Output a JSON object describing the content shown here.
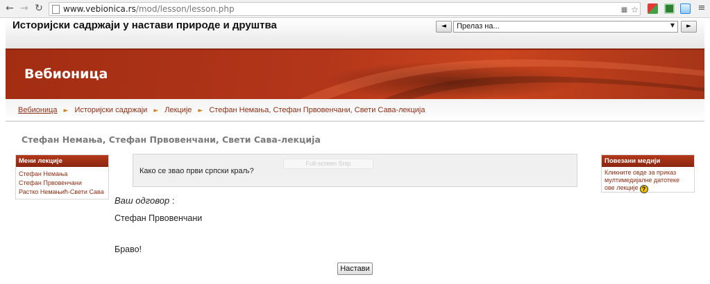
{
  "browser": {
    "back_glyph": "←",
    "forward_glyph": "→",
    "reload_glyph": "↻",
    "url_host": "www.vebionica.rs",
    "url_path": "/mod/lesson/lesson.php",
    "star_glyph": "☆"
  },
  "header": {
    "course_title": "Историјски садржаји у настави природе и друштва",
    "jump_prev": "◄",
    "jump_next": "►",
    "jump_select_value": "Прелаз на...",
    "jump_select_arrow": "▼"
  },
  "banner": {
    "site_name": "Вебионица"
  },
  "breadcrumb": {
    "items": [
      "Вебионица",
      "Историјски садржаји",
      "Лекције",
      "Стефан Немања, Стефан Првовенчани, Свети Сава-лекција"
    ],
    "separator": "►"
  },
  "page_title": "Стефан Немања, Стефан Првовенчани, Свети Сава-лекција",
  "lesson_menu": {
    "heading": "Мени лекције",
    "items": [
      "Стефан Немања",
      "Стефан Првовенчани",
      "Растко Немањић-Свети Сава"
    ]
  },
  "related_media": {
    "heading": "Повезани медији",
    "text_line1": "Кликните овде за приказ",
    "text_line2": "мултимедијалне датотеке",
    "text_line3": "ове лекције",
    "help_glyph": "?"
  },
  "question": {
    "text": "Како се звао први српски краљ?",
    "overlay_text": "Full-screen Snip"
  },
  "answer": {
    "label": "Ваш одговор",
    "colon": ":",
    "value": "Стефан Првовенчани"
  },
  "feedback": "Браво!",
  "continue_label": "Настави",
  "colors": {
    "accent": "#a22d12",
    "link": "#8b2e14",
    "separator": "#d08020"
  }
}
